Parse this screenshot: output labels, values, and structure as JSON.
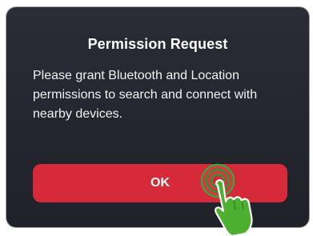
{
  "dialog": {
    "title": "Permission Request",
    "message": "Please grant Bluetooth and Location permissions to search and connect with nearby devices.",
    "ok_label": "OK"
  },
  "colors": {
    "dialog_background": "#25282f",
    "button": "#d62a3a",
    "tap_hand": "#4caf2f",
    "tap_rings": "#d62a3a"
  },
  "icons": {
    "tap_indicator": "tap-hand-icon"
  }
}
